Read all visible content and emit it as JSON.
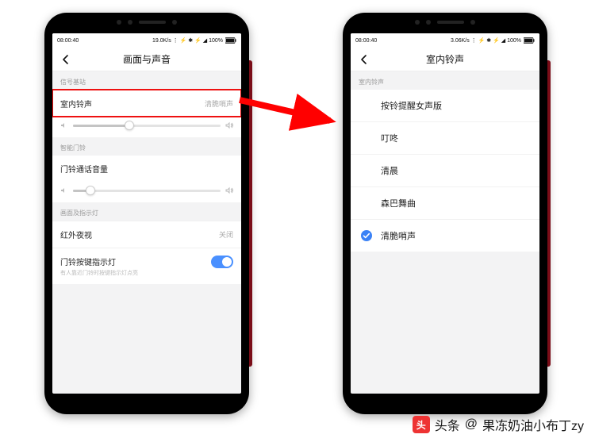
{
  "phone_left": {
    "status": {
      "time": "08:00:40",
      "right": "19.0K/s ⋮ ⚡ ✱ ⚡ ◢ 100%"
    },
    "nav": {
      "title": "画面与声音"
    },
    "section1": {
      "header": "信号基站",
      "ringtone_label": "室内铃声",
      "ringtone_value": "清脆哨声"
    },
    "slider1": {
      "pct": 38
    },
    "section2": {
      "header": "智能门铃",
      "volume_label": "门铃通话音量"
    },
    "slider2": {
      "pct": 12
    },
    "section3": {
      "header": "画面及指示灯",
      "ir_label": "红外夜视",
      "ir_value": "关闭",
      "led_label": "门铃按键指示灯",
      "led_hint": "有人靠近门铃时按键指示灯点亮",
      "led_on": true
    }
  },
  "phone_right": {
    "status": {
      "time": "08:00:40",
      "right": "3.06K/s ⋮ ⚡ ✱ ⚡ ◢ 100%"
    },
    "nav": {
      "title": "室内铃声"
    },
    "section_header": "室内铃声",
    "options": [
      {
        "label": "按铃提醒女声版",
        "selected": false
      },
      {
        "label": "叮咚",
        "selected": false
      },
      {
        "label": "清晨",
        "selected": false
      },
      {
        "label": "森巴舞曲",
        "selected": false
      },
      {
        "label": "清脆哨声",
        "selected": true
      }
    ]
  },
  "watermark": {
    "prefix": "头条",
    "at": "@",
    "name": "果冻奶油小布丁zy"
  }
}
